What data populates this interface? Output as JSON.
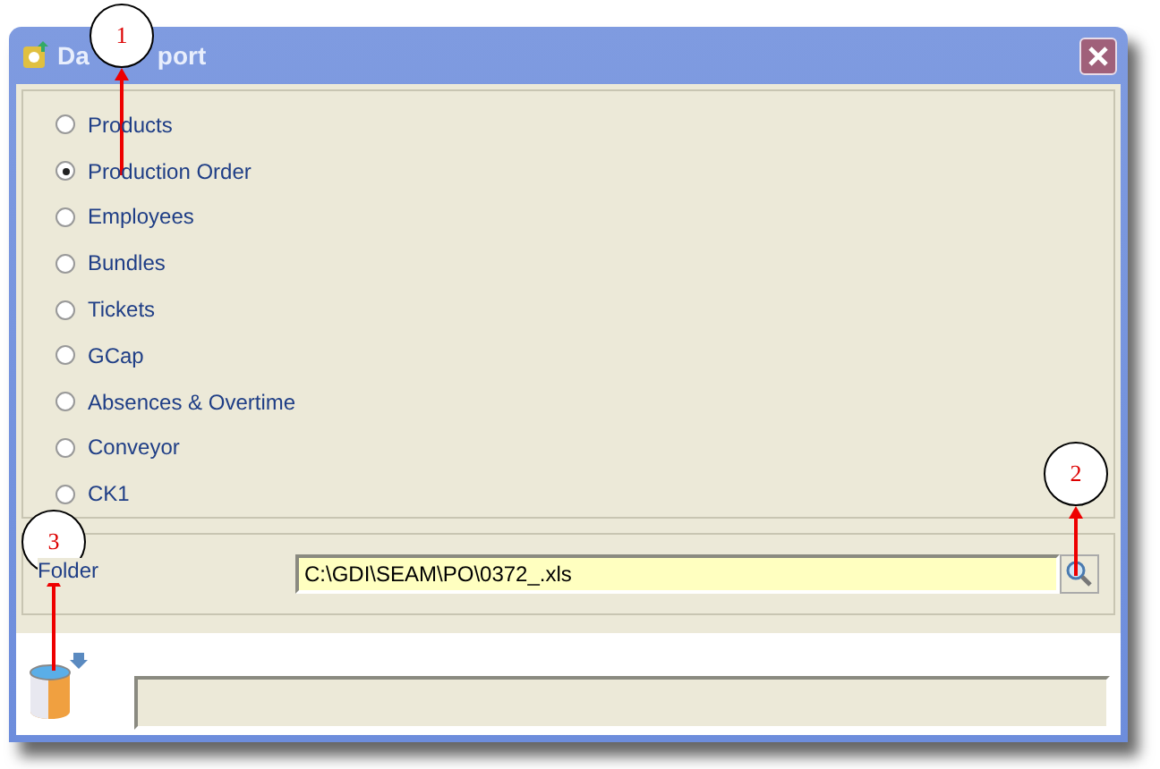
{
  "window": {
    "title_parts": [
      "Da",
      "port"
    ]
  },
  "options": [
    {
      "label": "Products",
      "selected": false
    },
    {
      "label": "Production Order",
      "selected": true
    },
    {
      "label": "Employees",
      "selected": false
    },
    {
      "label": "Bundles",
      "selected": false
    },
    {
      "label": "Tickets",
      "selected": false
    },
    {
      "label": "GCap",
      "selected": false
    },
    {
      "label": "Absences & Overtime",
      "selected": false
    },
    {
      "label": "Conveyor",
      "selected": false
    },
    {
      "label": "CK1",
      "selected": false
    }
  ],
  "folder": {
    "label": "Folder",
    "value": "C:\\GDI\\SEAM\\PO\\0372_.xls"
  },
  "progress": {
    "level": 0
  },
  "callouts": [
    {
      "number": "1"
    },
    {
      "number": "2"
    },
    {
      "number": "3"
    }
  ]
}
